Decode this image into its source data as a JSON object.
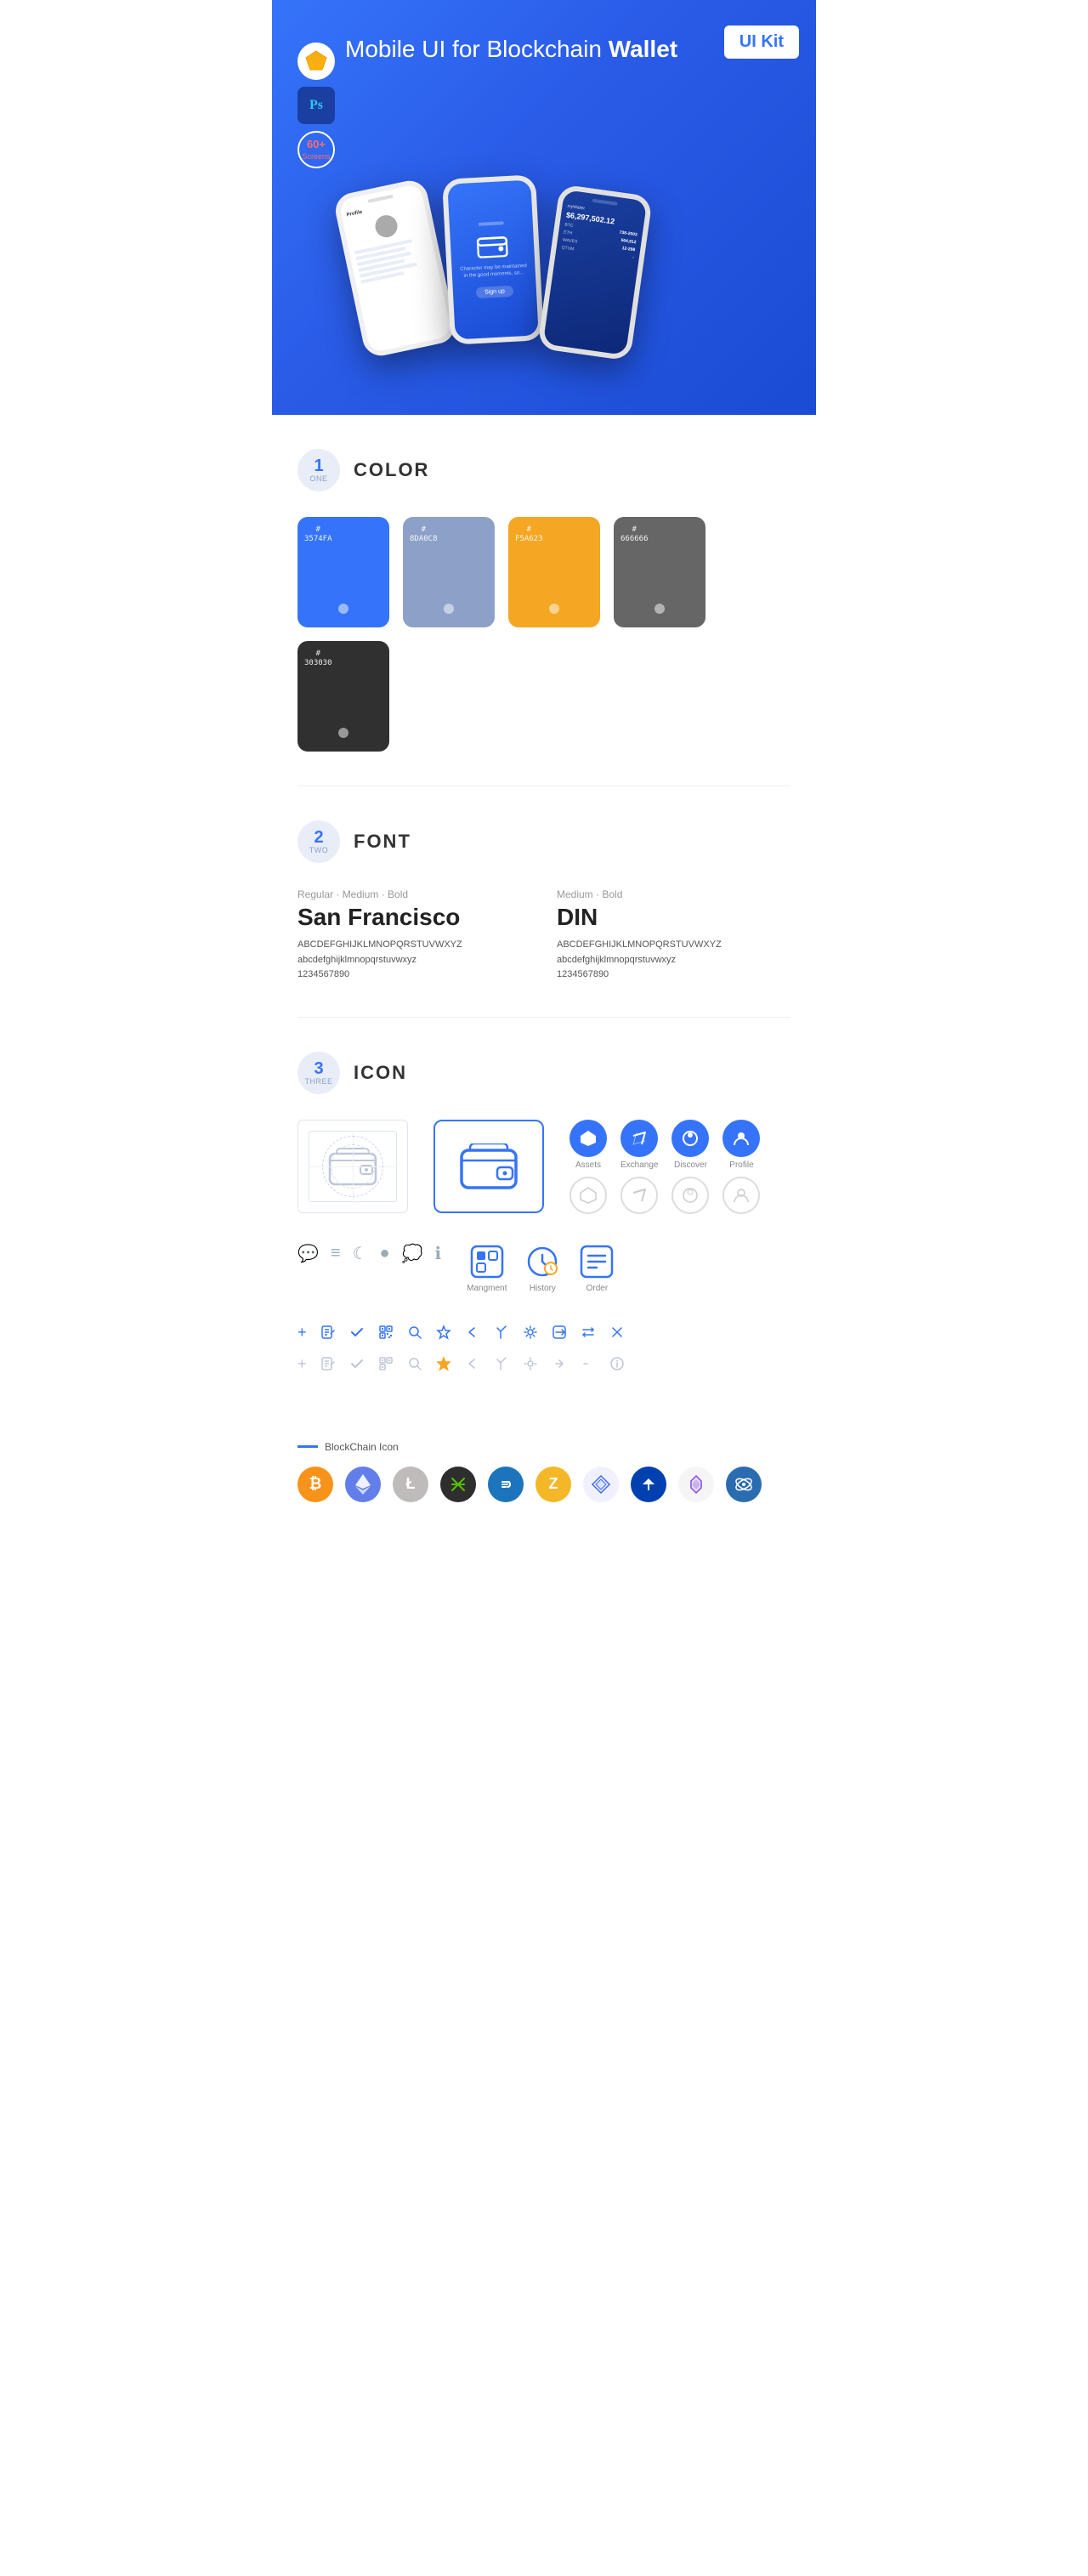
{
  "hero": {
    "title": "Mobile UI for Blockchain ",
    "title_bold": "Wallet",
    "badge": "UI Kit",
    "badges": [
      {
        "type": "sketch",
        "label": "Sketch"
      },
      {
        "type": "ps",
        "label": "Ps"
      },
      {
        "type": "screens",
        "line1": "60+",
        "line2": "Screens"
      }
    ]
  },
  "sections": {
    "color": {
      "number": "1",
      "word": "ONE",
      "title": "COLOR",
      "swatches": [
        {
          "hex": "#3574FA",
          "code": "#\n3574FA",
          "bg": "#3574fa"
        },
        {
          "hex": "#8DA0C8",
          "code": "#\n8DA0C8",
          "bg": "#8da0c8"
        },
        {
          "hex": "#F5A623",
          "code": "#\nF5A623",
          "bg": "#f5a623"
        },
        {
          "hex": "#666666",
          "code": "#\n666666",
          "bg": "#666666"
        },
        {
          "hex": "#303030",
          "code": "#\n303030",
          "bg": "#303030"
        }
      ]
    },
    "font": {
      "number": "2",
      "word": "TWO",
      "title": "FONT",
      "fonts": [
        {
          "label": "Regular · Medium · Bold",
          "name": "San Francisco",
          "uppercase": "ABCDEFGHIJKLMNOPQRSTUVWXYZ",
          "lowercase": "abcdefghijklmnopqrstuvwxyz",
          "numbers": "1234567890",
          "style": "sans"
        },
        {
          "label": "Medium · Bold",
          "name": "DIN",
          "uppercase": "ABCDEFGHIJKLMNOPQRSTUVWXYZ",
          "lowercase": "abcdefghijklmnopqrstuvwxyz",
          "numbers": "1234567890",
          "style": "din"
        }
      ]
    },
    "icon": {
      "number": "3",
      "word": "THREE",
      "title": "ICON",
      "named_icons": [
        {
          "label": "Assets",
          "color": "blue"
        },
        {
          "label": "Exchange",
          "color": "blue"
        },
        {
          "label": "Discover",
          "color": "blue"
        },
        {
          "label": "Profile",
          "color": "blue"
        }
      ],
      "app_icons": [
        {
          "label": "Mangment",
          "color": "blue"
        },
        {
          "label": "History",
          "color": "blue"
        },
        {
          "label": "Order",
          "color": "blue"
        }
      ],
      "blockchain_label": "BlockChain Icon",
      "crypto_icons": [
        {
          "symbol": "₿",
          "name": "Bitcoin",
          "class": "crypto-btc"
        },
        {
          "symbol": "Ξ",
          "name": "Ethereum",
          "class": "crypto-eth"
        },
        {
          "symbol": "Ł",
          "name": "Litecoin",
          "class": "crypto-ltc"
        },
        {
          "symbol": "N",
          "name": "NEO",
          "class": "crypto-neo"
        },
        {
          "symbol": "D",
          "name": "Dash",
          "class": "crypto-dash"
        },
        {
          "symbol": "Z",
          "name": "Zcash",
          "class": "crypto-zcash"
        },
        {
          "symbol": "⬡",
          "name": "Grid",
          "class": "crypto-grid"
        },
        {
          "symbol": "▲",
          "name": "Waves",
          "class": "crypto-waves"
        },
        {
          "symbol": "◈",
          "name": "Matic",
          "class": "crypto-matic"
        },
        {
          "symbol": "◇",
          "name": "Chain",
          "class": "crypto-matic2"
        }
      ]
    }
  }
}
